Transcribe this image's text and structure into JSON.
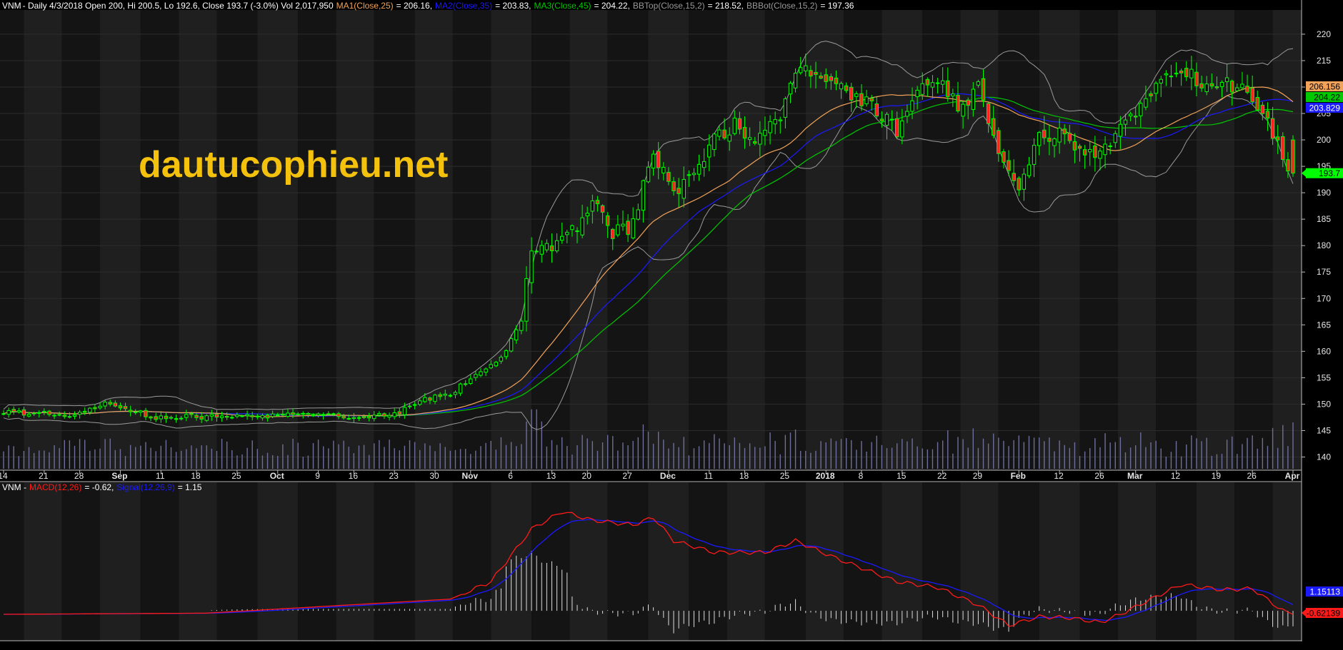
{
  "header": {
    "symbol": "VNM",
    "ohlc": "- Daily 4/3/2018 Open 200, Hi 200.5, Lo 192.6, Close 193.7 (-3.0%) Vol 2,017,950",
    "ma1_label": "MA1(Close,25)",
    "ma1_value": "= 206.16,",
    "ma2_label": "MA2(Close,35)",
    "ma2_value": "= 203.83,",
    "ma3_label": "MA3(Close,45)",
    "ma3_value": "= 204.22,",
    "bbtop_label": "BBTop(Close,15,2)",
    "bbtop_value": "= 218.52,",
    "bbbot_label": "BBBot(Close,15,2)",
    "bbbot_value": "= 197.36"
  },
  "macd_header": {
    "symbol": "VNM -",
    "macd_label": "MACD(12,26)",
    "macd_value": "= -0.62,",
    "signal_label": "Signal(12,26,9)",
    "signal_value": "= 1.15"
  },
  "watermark": "dautucophieu.net",
  "colors": {
    "bull": "#00ff00",
    "bear": "#ff2020",
    "ma1": "#f2a35a",
    "ma2": "#1a1aff",
    "ma3": "#00c800",
    "bb": "#9a9a9a",
    "volume": "#6e6e9a",
    "macd": "#ff1a1a",
    "signal": "#1a1aff",
    "hist": "#dddddd"
  },
  "chart_data": [
    {
      "type": "candlestick",
      "title": "VNM - Daily",
      "y_ticks": [
        140,
        145,
        150,
        155,
        160,
        165,
        170,
        175,
        180,
        185,
        190,
        195,
        200,
        205,
        210,
        215,
        220
      ],
      "ylim": [
        137.5,
        223.5
      ],
      "x_labels": [
        "14",
        "21",
        "28",
        "Sep",
        "11",
        "18",
        "25",
        "Oct",
        "9",
        "16",
        "23",
        "30",
        "Nov",
        "6",
        "13",
        "20",
        "27",
        "Dec",
        "11",
        "18",
        "25",
        "2018",
        "8",
        "15",
        "22",
        "29",
        "Feb",
        "12",
        "26",
        "Mar",
        "12",
        "19",
        "26",
        "Apr"
      ],
      "bold_labels": [
        "Sep",
        "Oct",
        "Nov",
        "Dec",
        "2018",
        "Feb",
        "Mar",
        "Apr"
      ],
      "last_labels": {
        "ma1": "206.156",
        "ma3": "204.22",
        "ma2": "203.829",
        "close": "193.7"
      },
      "last_values": {
        "ma1": 206.156,
        "ma3": 204.22,
        "ma2": 203.829,
        "close": 193.7
      },
      "price_anchors": [
        [
          0,
          148.5
        ],
        [
          15,
          148
        ],
        [
          20,
          150.5
        ],
        [
          30,
          147.5
        ],
        [
          60,
          148
        ],
        [
          70,
          147.5
        ],
        [
          78,
          148
        ],
        [
          80,
          150
        ],
        [
          88,
          152
        ],
        [
          94,
          156
        ],
        [
          99,
          160
        ],
        [
          102,
          166
        ],
        [
          104,
          180
        ],
        [
          108,
          180
        ],
        [
          112,
          183
        ],
        [
          116,
          188
        ],
        [
          120,
          182
        ],
        [
          124,
          184
        ],
        [
          128,
          198
        ],
        [
          132,
          190
        ],
        [
          136,
          194
        ],
        [
          140,
          200
        ],
        [
          144,
          203
        ],
        [
          148,
          200
        ],
        [
          152,
          203
        ],
        [
          156,
          212
        ],
        [
          160,
          213.5
        ],
        [
          164,
          211
        ],
        [
          168,
          208
        ],
        [
          172,
          206
        ],
        [
          176,
          202
        ],
        [
          180,
          209
        ],
        [
          184,
          211
        ],
        [
          188,
          206
        ],
        [
          192,
          210
        ],
        [
          196,
          197
        ],
        [
          200,
          190
        ],
        [
          204,
          200
        ],
        [
          208,
          201
        ],
        [
          212,
          198
        ],
        [
          216,
          197
        ],
        [
          220,
          202
        ],
        [
          224,
          207
        ],
        [
          228,
          212
        ],
        [
          232,
          213
        ],
        [
          236,
          211
        ],
        [
          240,
          211
        ],
        [
          244,
          210
        ],
        [
          248,
          206
        ],
        [
          252,
          197
        ],
        [
          254,
          193.7
        ]
      ],
      "volume_ylim": [
        0,
        100
      ],
      "macd_ylim": [
        -5,
        22
      ],
      "macd_last_labels": {
        "signal": "1.15113",
        "macd": "-0.62139"
      },
      "macd_anchors": [
        [
          0,
          -0.6
        ],
        [
          40,
          -0.4
        ],
        [
          88,
          2
        ],
        [
          96,
          5
        ],
        [
          104,
          14
        ],
        [
          110,
          17
        ],
        [
          116,
          15.5
        ],
        [
          124,
          14.7
        ],
        [
          128,
          16
        ],
        [
          132,
          12
        ],
        [
          140,
          10
        ],
        [
          150,
          10
        ],
        [
          156,
          12
        ],
        [
          164,
          9
        ],
        [
          176,
          5
        ],
        [
          184,
          4
        ],
        [
          192,
          1
        ],
        [
          198,
          -2.5
        ],
        [
          204,
          -1
        ],
        [
          210,
          -1.2
        ],
        [
          216,
          -2
        ],
        [
          220,
          -0.6
        ],
        [
          226,
          2
        ],
        [
          232,
          4.5
        ],
        [
          240,
          3.6
        ],
        [
          246,
          3.8
        ],
        [
          252,
          0
        ],
        [
          254,
          -0.62
        ]
      ]
    }
  ]
}
